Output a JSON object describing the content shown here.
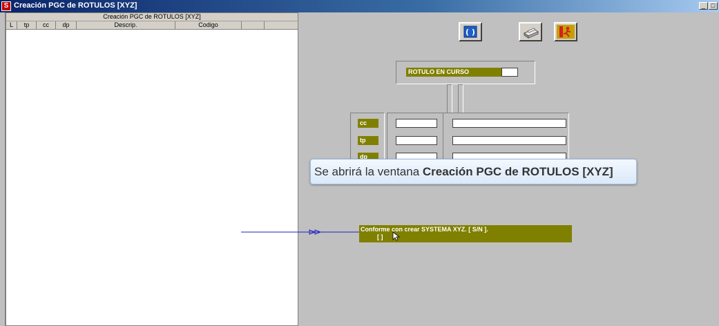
{
  "window": {
    "title": "Creación PGC de ROTULOS  [XYZ]",
    "icon": "app-logo-icon",
    "buttons": [
      "minimize-icon",
      "maximize-icon"
    ]
  },
  "grid": {
    "caption": "Creación PGC de ROTULOS  [XYZ]",
    "columns": [
      "L",
      "tp",
      "cc",
      "dp",
      "Descrip.",
      "Codigo",
      "",
      ""
    ]
  },
  "toolbar": {
    "buttons": [
      "refresh-icon",
      "print-icon",
      "exit-icon"
    ]
  },
  "rotulo": {
    "label": "ROTULO EN CURSO",
    "value": ""
  },
  "fields": [
    {
      "label": "cc",
      "code": "",
      "desc": ""
    },
    {
      "label": "tp",
      "code": "",
      "desc": ""
    },
    {
      "label": "dp",
      "code": "",
      "desc": ""
    }
  ],
  "tooltip": {
    "prefix": "Se abrirá la ventana ",
    "bold": "Creación PGC de ROTULOS  [XYZ]"
  },
  "prompt": {
    "line1": "Conforme con crear SYSTEMA XYZ.  [ S/N ].",
    "line2": "[ ]"
  },
  "colors": {
    "olive": "#808000",
    "titlebar": "#0a246a",
    "arrow": "#2020c0"
  }
}
